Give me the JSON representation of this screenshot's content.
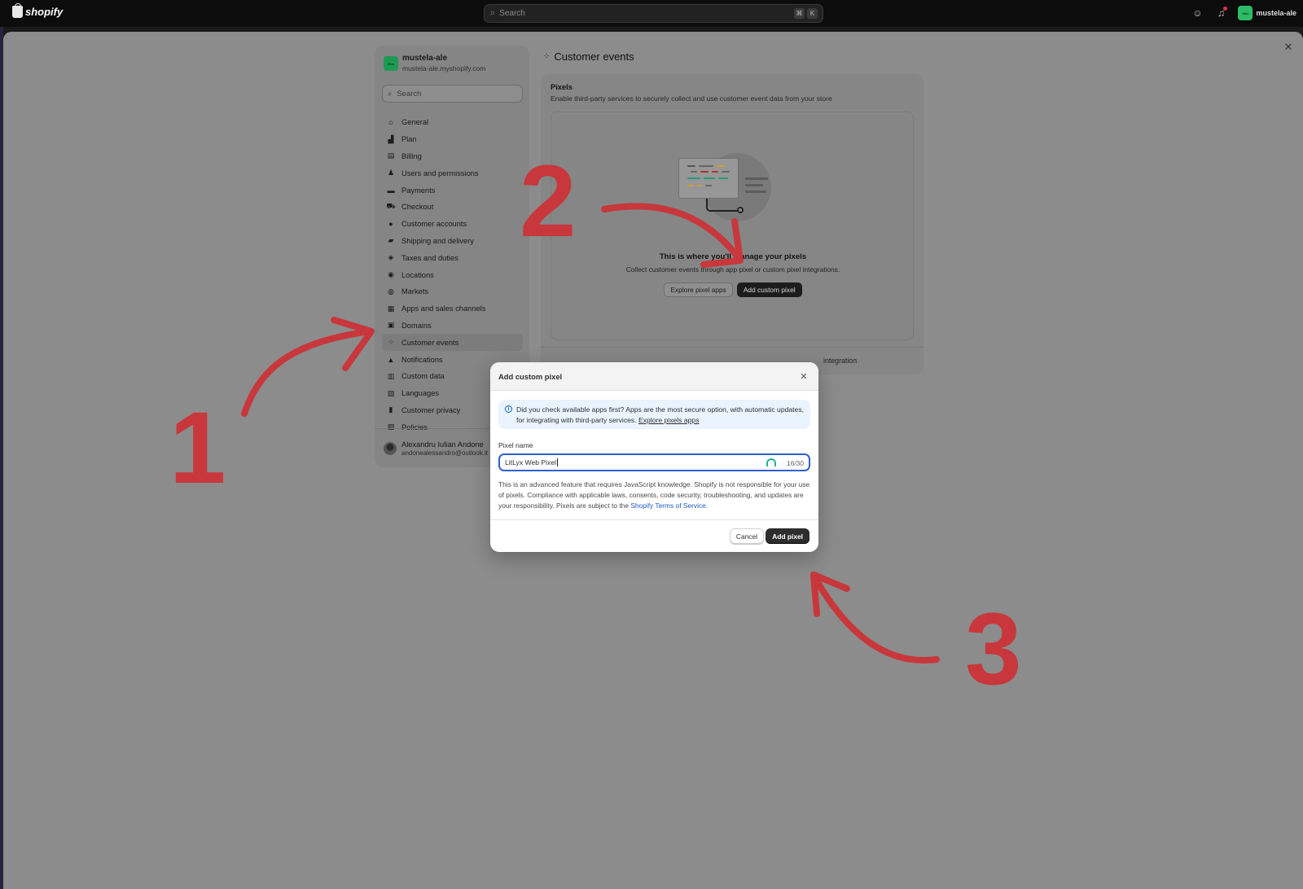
{
  "topbar": {
    "logo_text": "shopify",
    "search_placeholder": "Search",
    "kbd_1": "⌘",
    "kbd_2": "K",
    "store_name": "mustela-ale",
    "store_avatar_text": "Mus"
  },
  "sidebar": {
    "store_name": "mustela-ale",
    "store_domain": "mustela-ale.myshopify.com",
    "search_placeholder": "Search",
    "items": [
      {
        "label": "General",
        "icon": "store-icon"
      },
      {
        "label": "Plan",
        "icon": "chart-icon"
      },
      {
        "label": "Billing",
        "icon": "receipt-icon"
      },
      {
        "label": "Users and permissions",
        "icon": "users-icon"
      },
      {
        "label": "Payments",
        "icon": "payment-icon"
      },
      {
        "label": "Checkout",
        "icon": "cart-icon"
      },
      {
        "label": "Customer accounts",
        "icon": "person-icon"
      },
      {
        "label": "Shipping and delivery",
        "icon": "truck-icon"
      },
      {
        "label": "Taxes and duties",
        "icon": "tax-icon"
      },
      {
        "label": "Locations",
        "icon": "pin-icon"
      },
      {
        "label": "Markets",
        "icon": "globe-icon"
      },
      {
        "label": "Apps and sales channels",
        "icon": "apps-icon"
      },
      {
        "label": "Domains",
        "icon": "domain-icon"
      },
      {
        "label": "Customer events",
        "icon": "events-icon",
        "active": true
      },
      {
        "label": "Notifications",
        "icon": "bell-icon"
      },
      {
        "label": "Custom data",
        "icon": "data-icon"
      },
      {
        "label": "Languages",
        "icon": "language-icon"
      },
      {
        "label": "Customer privacy",
        "icon": "lock-icon"
      },
      {
        "label": "Policies",
        "icon": "policy-icon"
      }
    ],
    "user_name": "Alexandru Iulian Andone",
    "user_email": "andonealessandro@outlook.it"
  },
  "main": {
    "page_title": "Customer events",
    "pixels_heading": "Pixels",
    "pixels_description": "Enable third-party services to securely collect and use customer event data from your store",
    "empty_title": "This is where you'll manage your pixels",
    "empty_description": "Collect customer events through app pixel or custom pixel integrations.",
    "explore_button": "Explore pixel apps",
    "add_custom_button": "Add custom pixel",
    "footer_text": "integration"
  },
  "modal": {
    "title": "Add custom pixel",
    "banner_text": "Did you check available apps first? Apps are the most secure option, with automatic updates, for integrating with third-party services.",
    "banner_link": "Explore pixels apps",
    "field_label": "Pixel name",
    "field_value": "LitLyx Web Pixel",
    "char_count": "16/30",
    "note_text": "This is an advanced feature that requires JavaScript knowledge. Shopify is not responsible for your use of pixels. Compliance with applicable laws, consents, code security, troubleshooting, and updates are your responsibility. Pixels are subject to the",
    "note_link": "Shopify Terms of Service",
    "note_end": ".",
    "cancel_label": "Cancel",
    "add_label": "Add pixel"
  },
  "annotations": {
    "step_1": "1",
    "step_2": "2",
    "step_3": "3",
    "color": "#c8373b"
  }
}
